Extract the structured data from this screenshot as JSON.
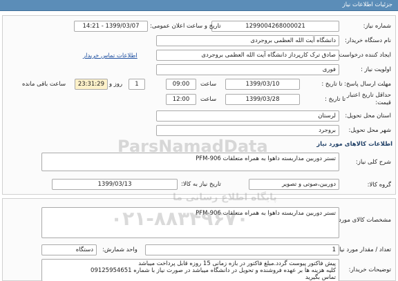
{
  "header": {
    "title": "جزئیات اطلاعات نیاز"
  },
  "details": {
    "need_number_label": "شماره نیاز:",
    "need_number": "1299004268000021",
    "announce_label": "تاریخ و ساعت اعلان عمومی:",
    "announce_value": "1399/03/07 - 14:21",
    "buyer_label": "نام دستگاه خریدار:",
    "buyer_value": "دانشگاه آیت الله العظمی بروجردی",
    "creator_label": "ایجاد کننده درخواست:",
    "creator_value": "صادق ترک کارپرداز دانشگاه آیت الله العظمی بروجردی",
    "contact_link": "اطلاعات تماس خریدار",
    "priority_label": "اولویت نیاز :",
    "priority_value": "فوری",
    "deadline_label": "مهلت ارسال پاسخ:  تا تاریخ :",
    "deadline_date": "1399/03/10",
    "time_label": "ساعت",
    "deadline_time": "09:00",
    "days_value": "1",
    "days_label": "روز و",
    "remaining_time": "23:31:29",
    "remaining_label": "ساعت باقی مانده",
    "validity_label_1": "حداقل تاریخ اعتبار",
    "validity_label_2": "قیمت:",
    "validity_until": "تا تاریخ :",
    "validity_date": "1399/03/28",
    "validity_time": "12:00",
    "province_label": "استان محل تحویل:",
    "province_value": "لرستان",
    "city_label": "شهر محل تحویل:",
    "city_value": "بروجرد"
  },
  "goods": {
    "section_title": "اطلاعات کالاهای مورد نیاز",
    "summary_label": "شرح کلی نیاز:",
    "summary_value": "تستر دوربین مداربسته داهوا به همراه متعلقات PFM-906",
    "group_label": "گروه کالا:",
    "group_value": "دوربین،صوتی و تصویر",
    "need_date_label": "تاریخ نیاز به کالا:",
    "need_date": "1399/03/13",
    "spec_label": "مشخصات کالای مورد نیاز:",
    "spec_value": "تستر دوربین مداربسته داهوا به همراه متعلقات PFM-906",
    "qty_label": "تعداد / مقدار مورد نیاز:",
    "qty_value": "1",
    "unit_label": "واحد شمارش:",
    "unit_value": "دستگاه",
    "buyer_notes_label": "توضیحات خریدار:",
    "notes_line1": "پیش فاکتور پیوست گردد.مبلغ فاکتور در بازه زمانی 15 روزه قابل پرداخت میباشد",
    "notes_line2": "کلیه هزینه ها بر عهده فروشنده و تحویل در دانشگاه میباشد در صورت نیاز با شماره 09125954651",
    "notes_line3": "تماس بگیرید"
  },
  "watermark": {
    "brand": "ParsNamadData",
    "line2": "پایگاه اطلاع رسانی ما",
    "phone": "۰۲۱-۸۸۳۴۹۶۷۰"
  },
  "colors": {
    "header": "#5b8db8",
    "remaining_bg": "#fdf1c9",
    "link": "#1c4ea0"
  }
}
